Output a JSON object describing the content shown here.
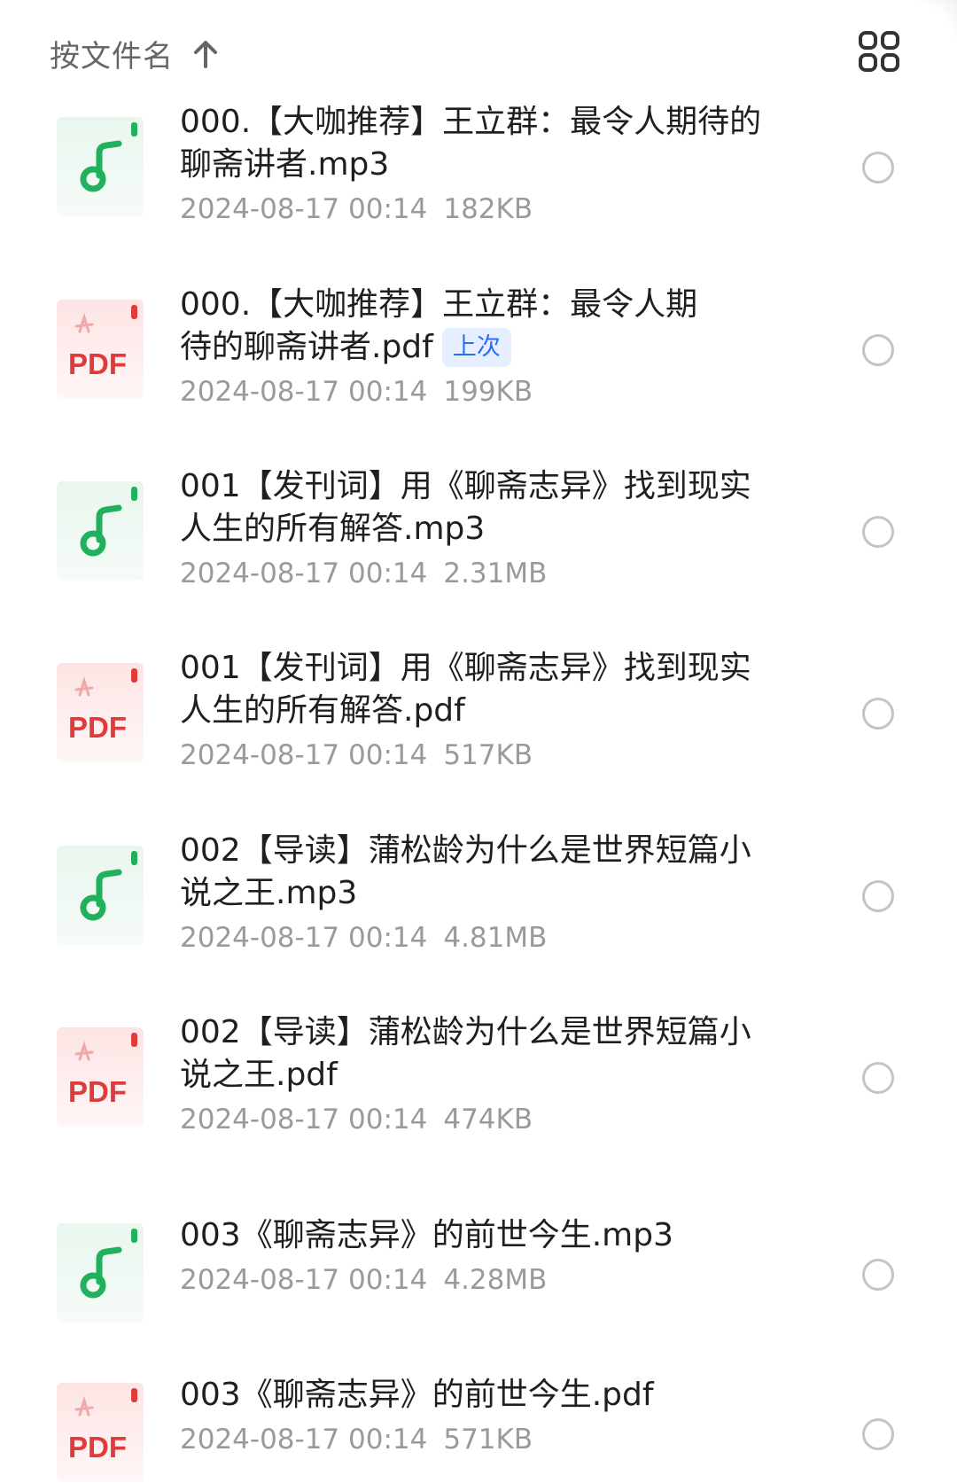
{
  "header": {
    "sort_label": "按文件名",
    "sort_direction_icon": "arrow-up-icon",
    "view_toggle_icon": "grid-view-icon"
  },
  "files": [
    {
      "type": "mp3",
      "title": "000.【大咖推荐】王立群：最令人期待的聊斋讲者.mp3",
      "line1": "000.【大咖推荐】王立群：最令人期待的",
      "line2": "聊斋讲者.mp3",
      "badge": "",
      "date": "2024-08-17 00:14",
      "size": "182KB"
    },
    {
      "type": "pdf",
      "title": "000.【大咖推荐】王立群：最令人期待的聊斋讲者.pdf",
      "line1": "000.【大咖推荐】王立群：最令人期",
      "line2": "待的聊斋讲者.pdf",
      "badge": "上次",
      "date": "2024-08-17 00:14",
      "size": "199KB"
    },
    {
      "type": "mp3",
      "title": "001【发刊词】用《聊斋志异》找到现实人生的所有解答.mp3",
      "line1": "001【发刊词】用《聊斋志异》找到现实",
      "line2": "人生的所有解答.mp3",
      "badge": "",
      "date": "2024-08-17 00:14",
      "size": "2.31MB"
    },
    {
      "type": "pdf",
      "title": "001【发刊词】用《聊斋志异》找到现实人生的所有解答.pdf",
      "line1": "001【发刊词】用《聊斋志异》找到现实",
      "line2": "人生的所有解答.pdf",
      "badge": "",
      "date": "2024-08-17 00:14",
      "size": "517KB"
    },
    {
      "type": "mp3",
      "title": "002【导读】蒲松龄为什么是世界短篇小说之王.mp3",
      "line1": "002【导读】蒲松龄为什么是世界短篇小",
      "line2": "说之王.mp3",
      "badge": "",
      "date": "2024-08-17 00:14",
      "size": "4.81MB"
    },
    {
      "type": "pdf",
      "title": "002【导读】蒲松龄为什么是世界短篇小说之王.pdf",
      "line1": "002【导读】蒲松龄为什么是世界短篇小",
      "line2": "说之王.pdf",
      "badge": "",
      "date": "2024-08-17 00:14",
      "size": "474KB"
    },
    {
      "type": "mp3",
      "title": "003《聊斋志异》的前世今生.mp3",
      "line1": "003《聊斋志异》的前世今生.mp3",
      "line2": "",
      "badge": "",
      "date": "2024-08-17 00:14",
      "size": "4.28MB"
    },
    {
      "type": "pdf",
      "title": "003《聊斋志异》的前世今生.pdf",
      "line1": "003《聊斋志异》的前世今生.pdf",
      "line2": "",
      "badge": "",
      "date": "2024-08-17 00:14",
      "size": "571KB"
    }
  ],
  "icons": {
    "mp3": "music-note-icon",
    "pdf": "pdf-file-icon",
    "pdf_label": "PDF"
  },
  "colors": {
    "audio_green": "#21b15c",
    "pdf_red": "#e03a3a",
    "badge_blue": "#2a6df4"
  }
}
